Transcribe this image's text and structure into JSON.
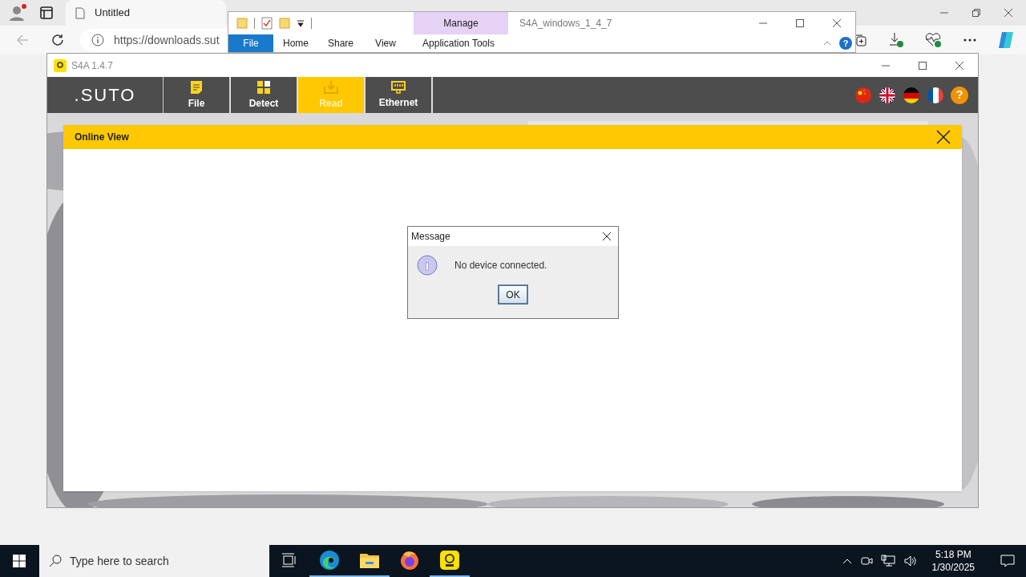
{
  "browser": {
    "tab_title": "Untitled",
    "url": "https://downloads.sut"
  },
  "explorer": {
    "title": "S4A_windows_1_4_7",
    "context_group": "Manage",
    "context_tab": "Application Tools",
    "help": "?",
    "ribbon_tabs": [
      {
        "label": "File",
        "selected": true
      },
      {
        "label": "Home",
        "selected": false
      },
      {
        "label": "Share",
        "selected": false
      },
      {
        "label": "View",
        "selected": false
      }
    ]
  },
  "app": {
    "title": "S4A 1.4.7",
    "logo": ".SUTO",
    "help": "?",
    "nav": [
      {
        "label": "File",
        "kind": "file",
        "selected": false
      },
      {
        "label": "Detect",
        "kind": "detect",
        "selected": false
      },
      {
        "label": "Read",
        "kind": "read",
        "selected": true
      },
      {
        "label": "Ethernet",
        "kind": "ethernet",
        "selected": false
      }
    ],
    "flags": [
      {
        "kind": "cn"
      },
      {
        "kind": "gb"
      },
      {
        "kind": "de"
      },
      {
        "kind": "fr"
      }
    ]
  },
  "panel": {
    "title": "Online View"
  },
  "dialog": {
    "title": "Message",
    "text": "No device connected.",
    "button": "OK"
  },
  "taskbar": {
    "search_placeholder": "Type here to search",
    "time": "5:18 PM",
    "date": "1/30/2025",
    "apps": [
      {
        "kind": "taskview",
        "running": false
      },
      {
        "kind": "edge",
        "running": true
      },
      {
        "kind": "folder",
        "running": true
      },
      {
        "kind": "firefox",
        "running": false
      },
      {
        "kind": "s4a",
        "running": true
      }
    ]
  }
}
